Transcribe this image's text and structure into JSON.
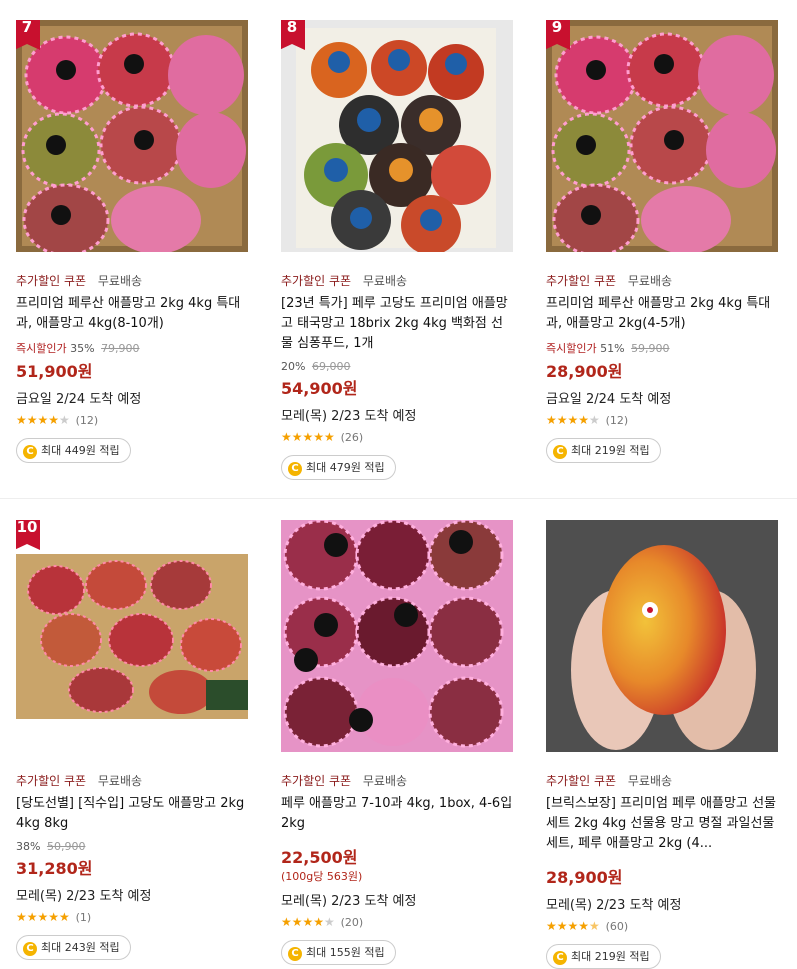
{
  "products": [
    {
      "rank": "7",
      "coupon_tag": "추가할인 쿠폰",
      "shipping_tag": "무료배송",
      "title": "프리미엄 페루산 애플망고 2kg 4kg 특대과, 애플망고 4kg(8-10개)",
      "discount_label": "즉시할인가",
      "discount_rate": "35%",
      "original_price": "79,900",
      "price": "51,900원",
      "delivery": "금요일 2/24 도착 예정",
      "rating": 4.0,
      "review_count": "(12)",
      "points": "최대 449원 적립"
    },
    {
      "rank": "8",
      "coupon_tag": "추가할인 쿠폰",
      "shipping_tag": "무료배송",
      "title": "[23년 특가] 페루 고당도 프리미엄 애플망고 태국망고 18brix 2kg 4kg 백화점 선물 심퐁푸드, 1개",
      "discount_label": "",
      "discount_rate": "20%",
      "original_price": "69,000",
      "price": "54,900원",
      "delivery": "모레(목) 2/23 도착 예정",
      "rating": 5.0,
      "review_count": "(26)",
      "points": "최대 479원 적립"
    },
    {
      "rank": "9",
      "coupon_tag": "추가할인 쿠폰",
      "shipping_tag": "무료배송",
      "title": "프리미엄 페루산 애플망고 2kg 4kg 특대과, 애플망고 2kg(4-5개)",
      "discount_label": "즉시할인가",
      "discount_rate": "51%",
      "original_price": "59,900",
      "price": "28,900원",
      "delivery": "금요일 2/24 도착 예정",
      "rating": 4.0,
      "review_count": "(12)",
      "points": "최대 219원 적립"
    },
    {
      "rank": "10",
      "coupon_tag": "추가할인 쿠폰",
      "shipping_tag": "무료배송",
      "title": "[당도선별] [직수입] 고당도 애플망고 2kg 4kg 8kg",
      "discount_label": "",
      "discount_rate": "38%",
      "original_price": "50,900",
      "price": "31,280원",
      "delivery": "모레(목) 2/23 도착 예정",
      "rating": 5.0,
      "review_count": "(1)",
      "points": "최대 243원 적립"
    },
    {
      "rank": "",
      "coupon_tag": "추가할인 쿠폰",
      "shipping_tag": "무료배송",
      "title": "페루 애플망고 7-10과 4kg, 1box, 4-6입 2kg",
      "discount_label": "",
      "discount_rate": "",
      "original_price": "",
      "price": "22,500원",
      "unit_price": "(100g당 563원)",
      "delivery": "모레(목) 2/23 도착 예정",
      "rating": 3.5,
      "review_count": "(20)",
      "points": "최대 155원 적립"
    },
    {
      "rank": "",
      "coupon_tag": "추가할인 쿠폰",
      "shipping_tag": "무료배송",
      "title": "[브릭스보장] 프리미엄 페루 애플망고 선물세트 2kg 4kg 선물용 망고 명절 과일선물세트, 페루 애플망고 2kg (4...",
      "discount_label": "",
      "discount_rate": "",
      "original_price": "",
      "price": "28,900원",
      "delivery": "모레(목) 2/23 도착 예정",
      "rating": 4.5,
      "review_count": "(60)",
      "points": "최대 219원 적립"
    }
  ],
  "colors": {
    "accent_red": "#c8102e",
    "price_red": "#b1261a",
    "star": "#f5a000",
    "coin": "#f5b400"
  },
  "icons": {
    "coin": "C"
  }
}
